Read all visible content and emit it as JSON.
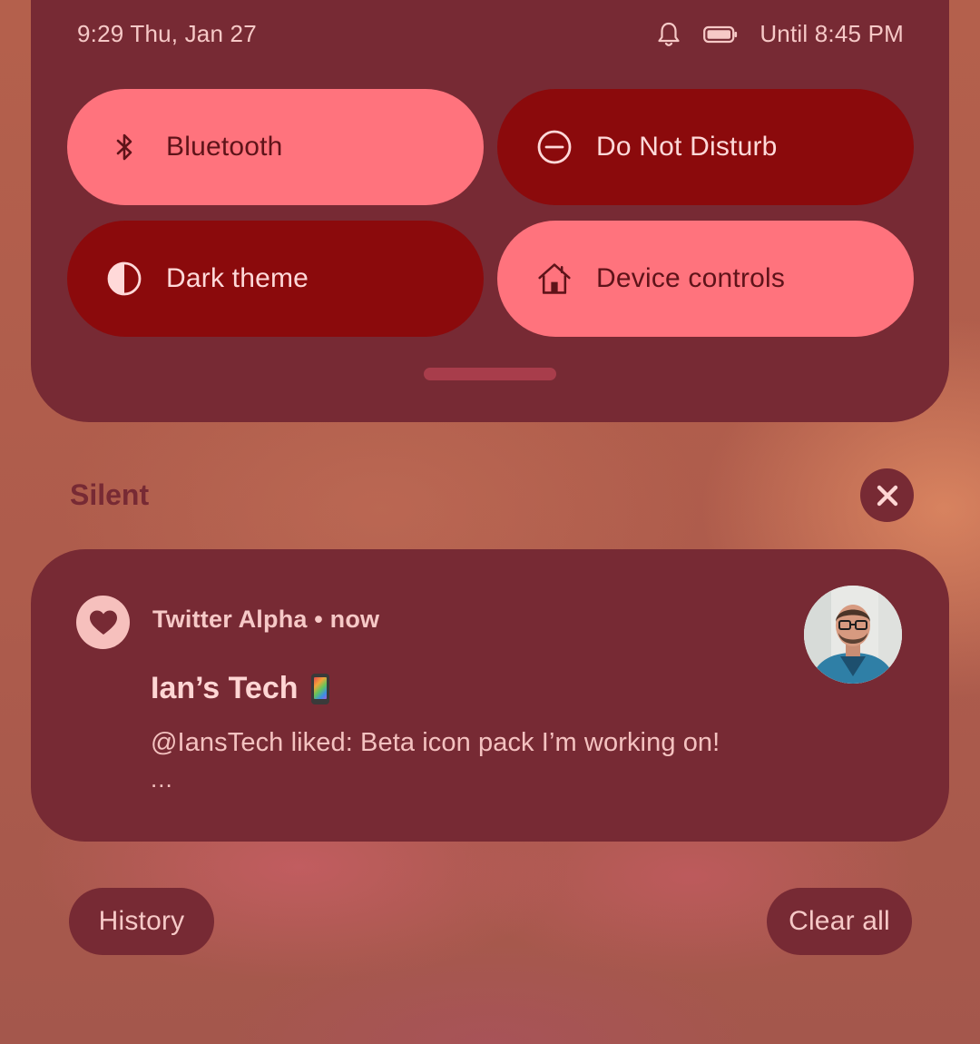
{
  "status_bar": {
    "time_date": "9:29 Thu, Jan 27",
    "icons": [
      "bell-icon",
      "battery-icon"
    ],
    "battery_text": "Until 8:45 PM"
  },
  "quick_settings": {
    "tiles": [
      {
        "label": "Bluetooth",
        "icon": "bluetooth-icon",
        "active": false
      },
      {
        "label": "Do Not Disturb",
        "icon": "do-not-disturb-icon",
        "active": true
      },
      {
        "label": "Dark theme",
        "icon": "dark-theme-icon",
        "active": true
      },
      {
        "label": "Device controls",
        "icon": "home-icon",
        "active": false
      }
    ]
  },
  "notifications": {
    "section_title": "Silent",
    "dismiss_icon": "close-icon",
    "items": [
      {
        "app_icon": "heart-icon",
        "app_line": "Twitter Alpha • now",
        "sender": "Ian’s Tech",
        "sender_emoji": "mobile-phone-icon",
        "message": "@IansTech liked: Beta icon pack I’m working on!",
        "ellipsis": "..."
      }
    ]
  },
  "footer": {
    "history_label": "History",
    "clear_all_label": "Clear all"
  },
  "colors": {
    "panel": "#772a34",
    "tile_inactive": "#ff737d",
    "tile_active": "#8b0a0c",
    "text_light": "#f6c9c7"
  }
}
